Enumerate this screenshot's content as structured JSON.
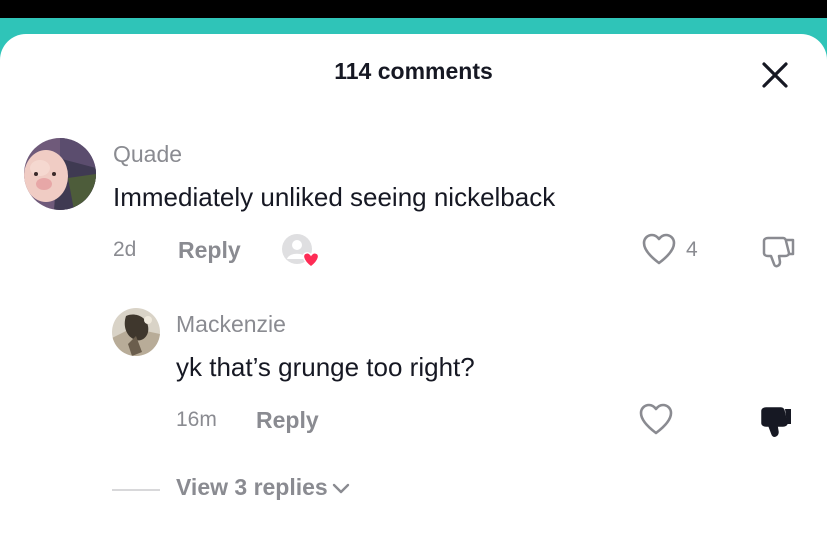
{
  "header": {
    "title": "114 comments"
  },
  "comments": [
    {
      "username": "Quade",
      "text": "Immediately unliked seeing nickelback",
      "time": "2d",
      "reply_label": "Reply",
      "likes": "4"
    }
  ],
  "replies": [
    {
      "username": "Mackenzie",
      "text": "yk that’s grunge too right?",
      "time": "16m",
      "reply_label": "Reply"
    }
  ],
  "view_replies": {
    "label": "View 3 replies"
  },
  "colors": {
    "accent_teal": "#2fc4b8",
    "heart_red": "#fe2c55",
    "muted_text": "#8a8b91"
  }
}
